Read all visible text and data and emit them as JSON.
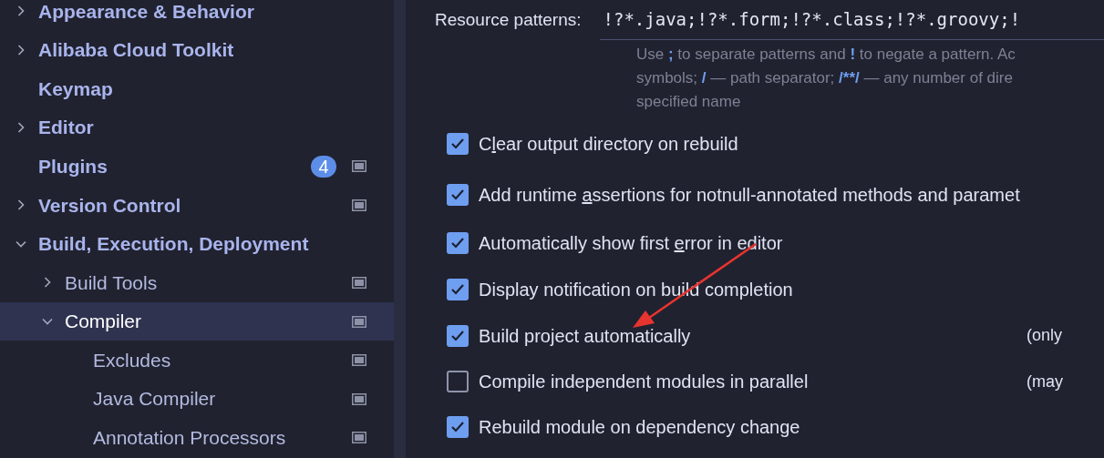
{
  "sidebar": {
    "items": [
      {
        "label": "Appearance & Behavior",
        "has_children": true,
        "expanded": false,
        "selected": false,
        "project_level": false
      },
      {
        "label": "Alibaba Cloud Toolkit",
        "has_children": true,
        "expanded": false,
        "selected": false,
        "project_level": false
      },
      {
        "label": "Keymap",
        "has_children": false,
        "selected": false,
        "project_level": false
      },
      {
        "label": "Editor",
        "has_children": true,
        "expanded": false,
        "selected": false,
        "project_level": false
      },
      {
        "label": "Plugins",
        "has_children": false,
        "selected": false,
        "project_level": true,
        "badge": "4"
      },
      {
        "label": "Version Control",
        "has_children": true,
        "expanded": false,
        "selected": false,
        "project_level": true
      },
      {
        "label": "Build, Execution, Deployment",
        "has_children": true,
        "expanded": true,
        "selected": false,
        "project_level": false,
        "children": [
          {
            "label": "Build Tools",
            "has_children": true,
            "expanded": false,
            "selected": false,
            "project_level": true
          },
          {
            "label": "Compiler",
            "has_children": true,
            "expanded": true,
            "selected": true,
            "project_level": true,
            "children": [
              {
                "label": "Excludes",
                "has_children": false,
                "selected": false,
                "project_level": true
              },
              {
                "label": "Java Compiler",
                "has_children": false,
                "selected": false,
                "project_level": true
              },
              {
                "label": "Annotation Processors",
                "has_children": false,
                "selected": false,
                "project_level": true
              }
            ]
          }
        ]
      }
    ]
  },
  "resource_patterns": {
    "label": "Resource patterns:",
    "value": "!?*.java;!?*.form;!?*.class;!?*.groovy;!",
    "hint_lines": [
      [
        {
          "text": "Use ",
          "code": false
        },
        {
          "text": ";",
          "code": true
        },
        {
          "text": " to separate patterns and ",
          "code": false
        },
        {
          "text": "!",
          "code": true
        },
        {
          "text": " to negate a pattern. Ac",
          "code": false
        }
      ],
      [
        {
          "text": "symbols; ",
          "code": false
        },
        {
          "text": "/",
          "code": true
        },
        {
          "text": " — path separator; ",
          "code": false
        },
        {
          "text": "/**/",
          "code": true
        },
        {
          "text": " — any number of dire",
          "code": false
        }
      ],
      [
        {
          "text": "specified name",
          "code": false
        }
      ]
    ]
  },
  "options": [
    {
      "before": "C",
      "mnemonic": "l",
      "after": "ear output directory on rebuild",
      "checked": true
    },
    {
      "before": "Add runtime ",
      "mnemonic": "a",
      "after": "ssertions for notnull-annotated methods and paramet",
      "checked": true
    },
    {
      "before": "Automatically show first ",
      "mnemonic": "e",
      "after": "rror in editor",
      "checked": true
    },
    {
      "before": "Display notification on build completion",
      "checked": true
    },
    {
      "before": "Build project automatically",
      "checked": true,
      "note": "(only"
    },
    {
      "before": "Compile independent modules in parallel",
      "checked": false,
      "note": "(may"
    },
    {
      "before": "Rebuild module on dependency change",
      "checked": true
    }
  ]
}
